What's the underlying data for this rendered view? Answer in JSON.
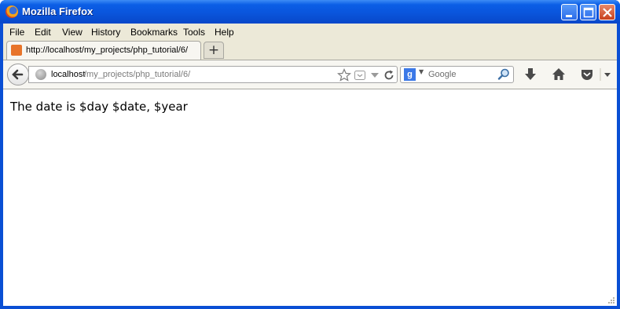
{
  "window": {
    "title": "Mozilla Firefox"
  },
  "menu": {
    "items": [
      {
        "label": "File"
      },
      {
        "label": "Edit"
      },
      {
        "label": "View"
      },
      {
        "label": "History"
      },
      {
        "label": "Bookmarks"
      },
      {
        "label": "Tools"
      },
      {
        "label": "Help"
      }
    ]
  },
  "tab": {
    "label": "http://localhost/my_projects/php_tutorial/6/"
  },
  "newtab": {
    "label": "+"
  },
  "url": {
    "host": "localhost",
    "path": "/my_projects/php_tutorial/6/"
  },
  "search": {
    "engine_label": "g",
    "placeholder": "Google"
  },
  "page": {
    "text": "The date is $day $date, $year"
  },
  "colors": {
    "titlebar": "#0a55dc",
    "chrome": "#ece9d8",
    "accent": "#3b78e7"
  }
}
